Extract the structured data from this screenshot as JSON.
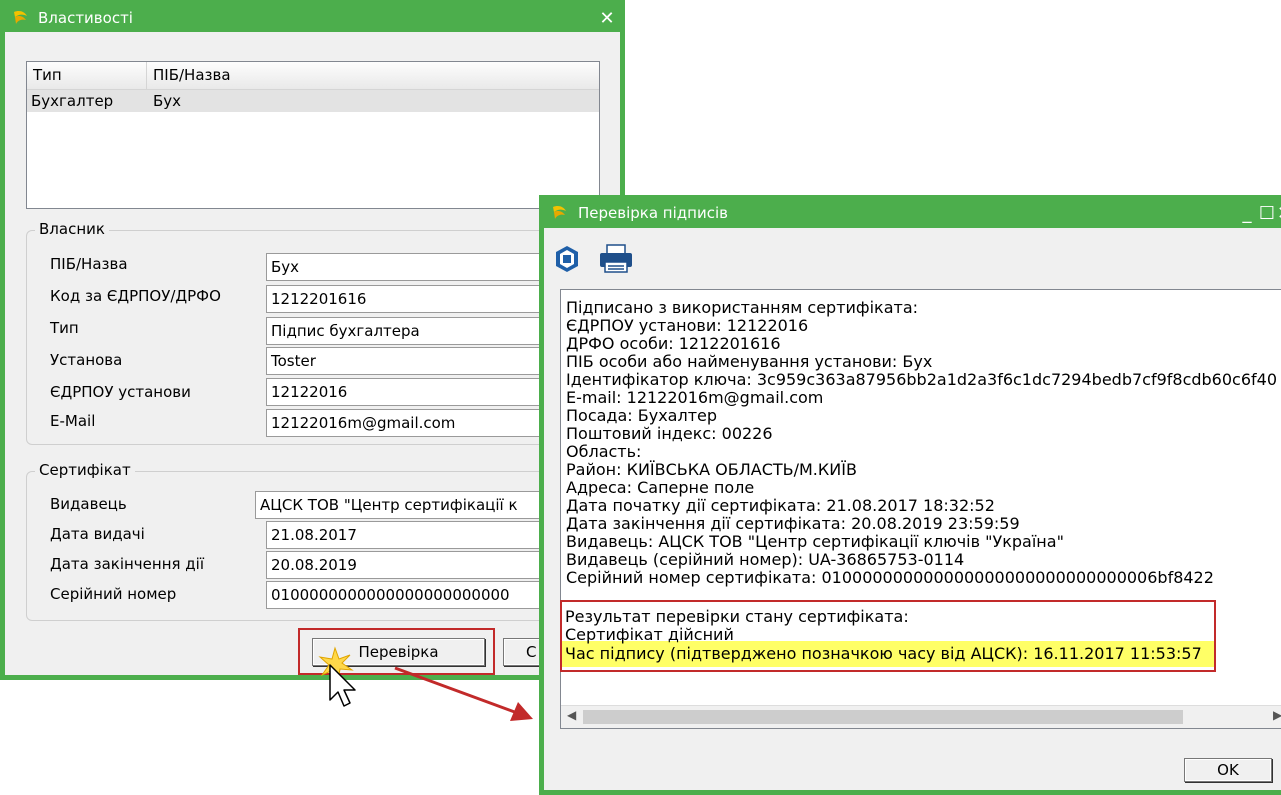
{
  "win1": {
    "title": "Властивості",
    "list": {
      "col_type": "Тип",
      "col_name": "ПІБ/Назва",
      "row": {
        "type": "Бухгалтер",
        "name": "Бух"
      }
    },
    "owner": {
      "group_title": "Власник",
      "fields": [
        {
          "label": "ПІБ/Назва",
          "value": "Бух"
        },
        {
          "label": "Код за ЄДРПОУ/ДРФО",
          "value": "1212201616"
        },
        {
          "label": "Тип",
          "value": "Підпис бухгалтера"
        },
        {
          "label": "Установа",
          "value": "Toster"
        },
        {
          "label": "ЄДРПОУ установи",
          "value": "12122016"
        },
        {
          "label": "E-Mail",
          "value": "12122016m@gmail.com"
        }
      ]
    },
    "cert": {
      "group_title": "Сертифікат",
      "fields": [
        {
          "label": "Видавець",
          "value": "АЦСК ТОВ \"Центр сертифікації к"
        },
        {
          "label": "Дата видачі",
          "value": "21.08.2017"
        },
        {
          "label": "Дата закінчення дії",
          "value": "20.08.2019"
        },
        {
          "label": "Серійний номер",
          "value": "0100000000000000000000000"
        }
      ]
    },
    "verify_button": "Перевірка",
    "second_button": "С"
  },
  "win2": {
    "title": "Перевірка підписів",
    "lines": [
      "Підписано з використанням сертифіката:",
      "ЄДРПОУ установи: 12122016",
      "ДРФО особи: 1212201616",
      "ПІБ особи або найменування установи: Бух",
      "Ідентифікатор ключа: 3c959c363a87956bb2a1d2a3f6c1dc7294bedb7cf9f8cdb60c6f40",
      "E-mail: 12122016m@gmail.com",
      "Посада: Бухалтер",
      "Поштовий індекс: 00226",
      "Область:",
      "Район: КИЇВСЬКА ОБЛАСТЬ/М.КИЇВ",
      "Адреса: Саперне поле",
      "Дата початку дії сертифіката: 21.08.2017 18:32:52",
      "Дата закінчення дії сертифіката: 20.08.2019 23:59:59",
      "Видавець: АЦСК ТОВ \"Центр сертифікації ключів \"Україна\"",
      "Видавець (серійний номер): UA-36865753-0114",
      "Серійний номер сертифіката: 010000000000000000000000000000006bf8422"
    ],
    "result_lines": [
      "Результат перевірки стану сертифіката:",
      "Сертифікат дійсний",
      "Час підпису (підтверджено позначкою часу від АЦСК): 16.11.2017 11:53:57"
    ],
    "ok_button": "OK"
  },
  "colors": {
    "window_green": "#4cae4c",
    "annotation_red": "#c22a2a",
    "highlight_yellow": "#ffff66"
  }
}
